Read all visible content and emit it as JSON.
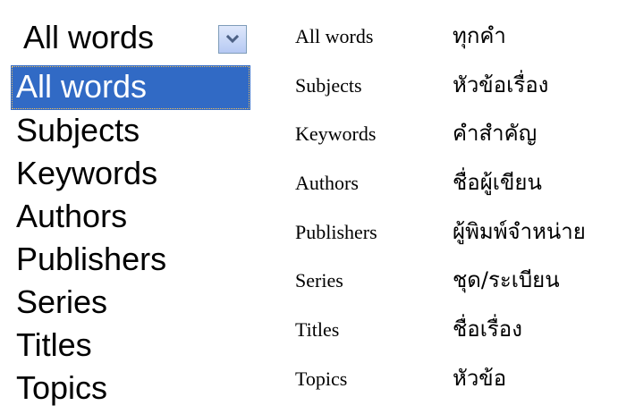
{
  "dropdown": {
    "selected_value": "All words",
    "arrow_icon": "chevron-down-icon",
    "options": [
      {
        "label": "All words",
        "selected": true
      },
      {
        "label": "Subjects",
        "selected": false
      },
      {
        "label": "Keywords",
        "selected": false
      },
      {
        "label": "Authors",
        "selected": false
      },
      {
        "label": "Publishers",
        "selected": false
      },
      {
        "label": "Series",
        "selected": false
      },
      {
        "label": "Titles",
        "selected": false
      },
      {
        "label": "Topics",
        "selected": false
      }
    ],
    "colors": {
      "selection_bg": "#316ac5",
      "selection_text": "#ffffff",
      "arrow_border": "#7f9db9",
      "arrow_glyph": "#4d6185"
    }
  },
  "translations": [
    {
      "en": "All words",
      "th": "ทุกคำ"
    },
    {
      "en": "Subjects",
      "th": "หัวข้อเรื่อง"
    },
    {
      "en": "Keywords",
      "th": "คำสำคัญ"
    },
    {
      "en": "Authors",
      "th": "ชื่อผู้เขียน"
    },
    {
      "en": "Publishers",
      "th": "ผู้พิมพ์จำหน่าย"
    },
    {
      "en": "Series",
      "th": "ชุด/ระเบียน"
    },
    {
      "en": "Titles",
      "th": "ชื่อเรื่อง"
    },
    {
      "en": "Topics",
      "th": "หัวข้อ"
    }
  ]
}
